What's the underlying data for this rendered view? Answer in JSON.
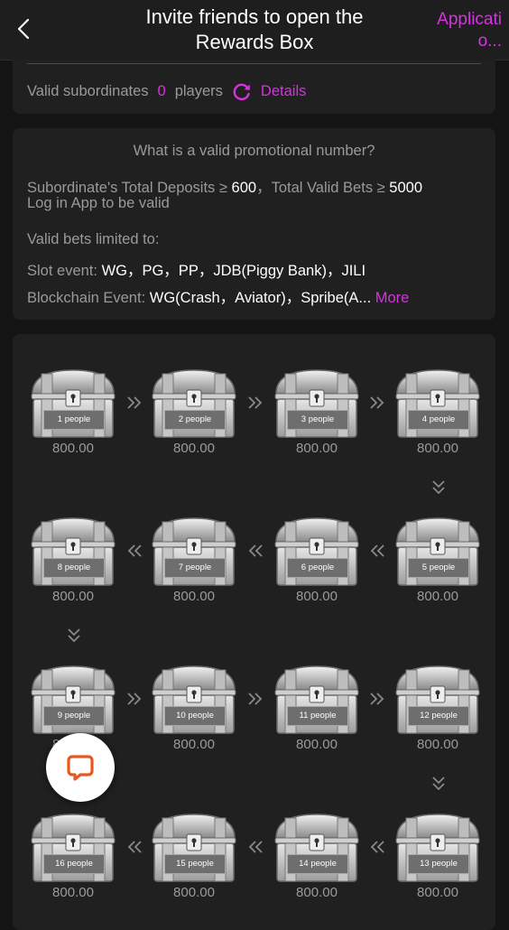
{
  "header": {
    "title": "Invite friends to open the Rewards Box",
    "action_label": "Applicati o..."
  },
  "summary": {
    "label": "Valid subordinates",
    "count": "0",
    "unit": "players",
    "details_label": "Details"
  },
  "rules": {
    "question": "What is a valid promotional number?",
    "deposit_label": "Subordinate's Total Deposits ≥ ",
    "deposit_value": "600",
    "bets_label": "，Total Valid Bets ≥ ",
    "bets_value": "5000",
    "login_note": "Log in App to be valid",
    "limited_title": "Valid bets limited to:",
    "slot_label": "Slot event: ",
    "slot_value": "WG，PG，PP，JDB(Piggy Bank)，JILI",
    "chain_label": "Blockchain Event: ",
    "chain_value": "WG(Crash，Aviator)，Spribe(A...",
    "more_label": "More"
  },
  "rewards": [
    {
      "label": "1 people",
      "amount": "800.00"
    },
    {
      "label": "2 people",
      "amount": "800.00"
    },
    {
      "label": "3 people",
      "amount": "800.00"
    },
    {
      "label": "4 people",
      "amount": "800.00"
    },
    {
      "label": "5 people",
      "amount": "800.00"
    },
    {
      "label": "6 people",
      "amount": "800.00"
    },
    {
      "label": "7 people",
      "amount": "800.00"
    },
    {
      "label": "8 people",
      "amount": "800.00"
    },
    {
      "label": "9 people",
      "amount": "800.00"
    },
    {
      "label": "10 people",
      "amount": "800.00"
    },
    {
      "label": "11 people",
      "amount": "800.00"
    },
    {
      "label": "12 people",
      "amount": "800.00"
    },
    {
      "label": "13 people",
      "amount": "800.00"
    },
    {
      "label": "14 people",
      "amount": "800.00"
    },
    {
      "label": "15 people",
      "amount": "800.00"
    },
    {
      "label": "16 people",
      "amount": "800.00"
    }
  ],
  "colors": {
    "accent": "#d633e0",
    "background": "#141414",
    "card": "#202020",
    "muted_text": "#9a9a9a",
    "chat_icon": "#e8571f"
  },
  "icons": {
    "back": "chevron-left-icon",
    "refresh": "refresh-icon",
    "chest": "treasure-chest-icon",
    "next": "double-chevron-right-icon",
    "prev": "double-chevron-left-icon",
    "down": "double-chevron-down-icon",
    "chat": "chat-bubble-icon"
  }
}
